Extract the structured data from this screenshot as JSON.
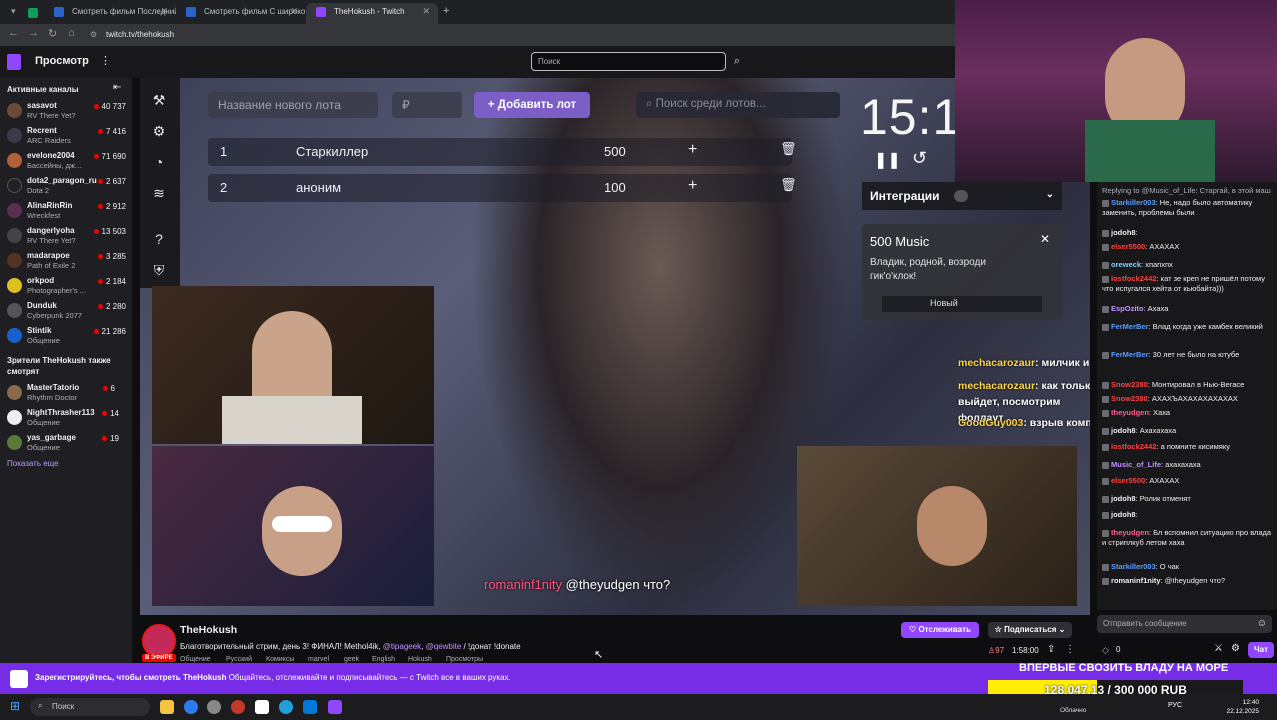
{
  "browser": {
    "tabs": [
      {
        "title": "Смотреть фильм Последний о",
        "active": false
      },
      {
        "title": "Смотреть фильм С широко за",
        "active": false
      },
      {
        "title": "TheHokush - Twitch",
        "active": true
      }
    ],
    "url": "twitch.tv/thehokush"
  },
  "topnav": {
    "browse": "Просмотр",
    "search_placeholder": "Поиск"
  },
  "sidebar": {
    "active_header": "Активные каналы",
    "channels": [
      {
        "name": "sasavot",
        "game": "RV There Yet?",
        "viewers": "40 737",
        "color": "#6b4a3a"
      },
      {
        "name": "Recrent",
        "game": "ARC Raiders",
        "viewers": "7 416",
        "color": "#3a3a4a"
      },
      {
        "name": "evelone2004",
        "game": "Бассейны, дж...",
        "viewers": "71 690",
        "color": "#b0603a"
      },
      {
        "name": "dota2_paragon_ru",
        "game": "Dota 2",
        "viewers": "2 637",
        "color": "#222"
      },
      {
        "name": "AlinaRinRin",
        "game": "Wreckfest",
        "viewers": "2 912",
        "color": "#5a3050"
      },
      {
        "name": "dangerlyoha",
        "game": "RV There Yet?",
        "viewers": "13 503",
        "color": "#444"
      },
      {
        "name": "madarapoe",
        "game": "Path of Exile 2",
        "viewers": "3 285",
        "color": "#553322"
      },
      {
        "name": "orkpod",
        "game": "Photographer's ...",
        "viewers": "2 184",
        "color": "#ddc020"
      },
      {
        "name": "Dunduk",
        "game": "Cyberpunk 2077",
        "viewers": "2 280",
        "color": "#555"
      },
      {
        "name": "Stintik",
        "game": "Общение",
        "viewers": "21 286",
        "color": "#1a5fcf"
      }
    ],
    "also_header": "Зрители TheHokush также смотрят",
    "also": [
      {
        "name": "MasterTatorio",
        "game": "Rhythm Doctor",
        "viewers": "6",
        "color": "#8a6a4a"
      },
      {
        "name": "NightThrasher113",
        "game": "Общение",
        "viewers": "14",
        "color": "#eee"
      },
      {
        "name": "yas_garbage",
        "game": "Общение",
        "viewers": "19",
        "color": "#5a7a3a"
      }
    ],
    "show_more": "Показать еще"
  },
  "overlay": {
    "new_lot_placeholder": "Название нового лота",
    "price_placeholder": "₽",
    "add_lot": "Добавить лот",
    "lot_search": "Поиск среди лотов...",
    "lots": [
      {
        "num": "1",
        "name": "Старкиллер",
        "amount": "500"
      },
      {
        "num": "2",
        "name": "аноним",
        "amount": "100"
      }
    ],
    "timer": "15:1",
    "integrations": "Интеграции",
    "music_title": "500 Music",
    "music_desc": "Владик, родной, возроди гик'о'клок!",
    "music_new": "Новый",
    "ov_chat": [
      {
        "user": "mechacarozaur",
        "text": ": милчик и николакус закидывали"
      },
      {
        "user": "mechacarozaur",
        "text": ": как только выйдет, посмотрим фоллаут"
      },
      {
        "user": "GoodGuy003",
        "text": ": взрыв компа это опасно"
      }
    ],
    "bottom_chat_user": "romaninf1nity",
    "bottom_chat_text": "@theyudgen что?"
  },
  "channel": {
    "name": "TheHokush",
    "live": "В ЭФИРЕ",
    "title_prefix": "Благотворительный стрим, день 3! ФИНАЛ! Methol4ik, ",
    "mention1": "@tipageek",
    "sep": ", ",
    "mention2": "@qewbite",
    "title_suffix": " / !донат !donate",
    "tags": [
      "Общение",
      "Русский",
      "Комиксы",
      "marvel",
      "geek",
      "English",
      "Hokush",
      "Просмотры"
    ],
    "follow": "Отслеживать",
    "subscribe": "Подписаться",
    "viewers": "97",
    "uptime": "1:58:00"
  },
  "chat": {
    "messages": [
      {
        "user": "",
        "text": "Replying to @Music_of_Life: Старгай, в этой маш",
        "color": "#adadb8"
      },
      {
        "user": "Starkiller003",
        "text": ": Не, надо было автоматику заменить, проблемы были",
        "color": "#5c9cff"
      },
      {
        "user": "jodoh8",
        "text": ":",
        "color": "#efeff1"
      },
      {
        "user": "elser5500",
        "text": ": АХАХАХ",
        "color": "#ff4040"
      },
      {
        "user": "oreweck",
        "text": ": хпапхпх",
        "color": "#7fd0ff"
      },
      {
        "user": "lostfock2442",
        "text": ": кат зе креп не пришёл потому что испугался хейта от кьюбайта)))",
        "color": "#ff4040"
      },
      {
        "user": "EspOzito",
        "text": ": Ахаха",
        "color": "#bf94ff"
      },
      {
        "user": "FerMerBer",
        "text": ": Влад когда уже камбек великий",
        "color": "#5c9cff"
      },
      {
        "user": "FerMerBer",
        "text": ": 30 лет не было на ютубе",
        "color": "#5c9cff"
      },
      {
        "user": "Snow2380",
        "text": ": Монтировал в Нью-Вегасе",
        "color": "#ff4040"
      },
      {
        "user": "Snow2380",
        "text": ": АХАХЪАХАХАХАХАХАХ",
        "color": "#ff4040"
      },
      {
        "user": "theyudgen",
        "text": ": Хаха",
        "color": "#ff6090"
      },
      {
        "user": "jodoh8",
        "text": ": Ахахахаха",
        "color": "#efeff1"
      },
      {
        "user": "lostfock2442",
        "text": ": а помните кисимяку",
        "color": "#ff4040"
      },
      {
        "user": "Music_of_Life",
        "text": ": ахахахаха",
        "color": "#bf94ff"
      },
      {
        "user": "elser5500",
        "text": ": АХАХАХ",
        "color": "#ff4040"
      },
      {
        "user": "jodoh8",
        "text": ": Ролик отменят",
        "color": "#efeff1"
      },
      {
        "user": "jodoh8",
        "text": ":",
        "color": "#efeff1"
      },
      {
        "user": "theyudgen",
        "text": ": Бл вспомнил ситуацию про влада и стриплкуб летом хаха",
        "color": "#ff6090"
      },
      {
        "user": "Starkiller003",
        "text": ": О чак",
        "color": "#5c9cff"
      },
      {
        "user": "romaninf1nity",
        "text": ": @theyudgen что?",
        "color": "#efeff1"
      }
    ],
    "input_placeholder": "Отправить сообщение",
    "chat_button": "Чат",
    "points": "0"
  },
  "donation": {
    "headline": "ВПЕРВЫЕ СВОЗИТЬ ВЛАДУ НА МОРЕ",
    "progress_text": "128 047,13 / 300 000 RUB",
    "progress": 0.427
  },
  "register": {
    "bold": "Зарегистрируйтесь, чтобы смотреть TheHokush",
    "rest": " Общайтесь, отслеживайте и подписывайтесь — с Twitch все в ваших руках."
  },
  "taskbar": {
    "search": "Поиск",
    "weather": "Облачно",
    "lang": "РУС",
    "time": "12:40",
    "date": "22.12.2025"
  }
}
